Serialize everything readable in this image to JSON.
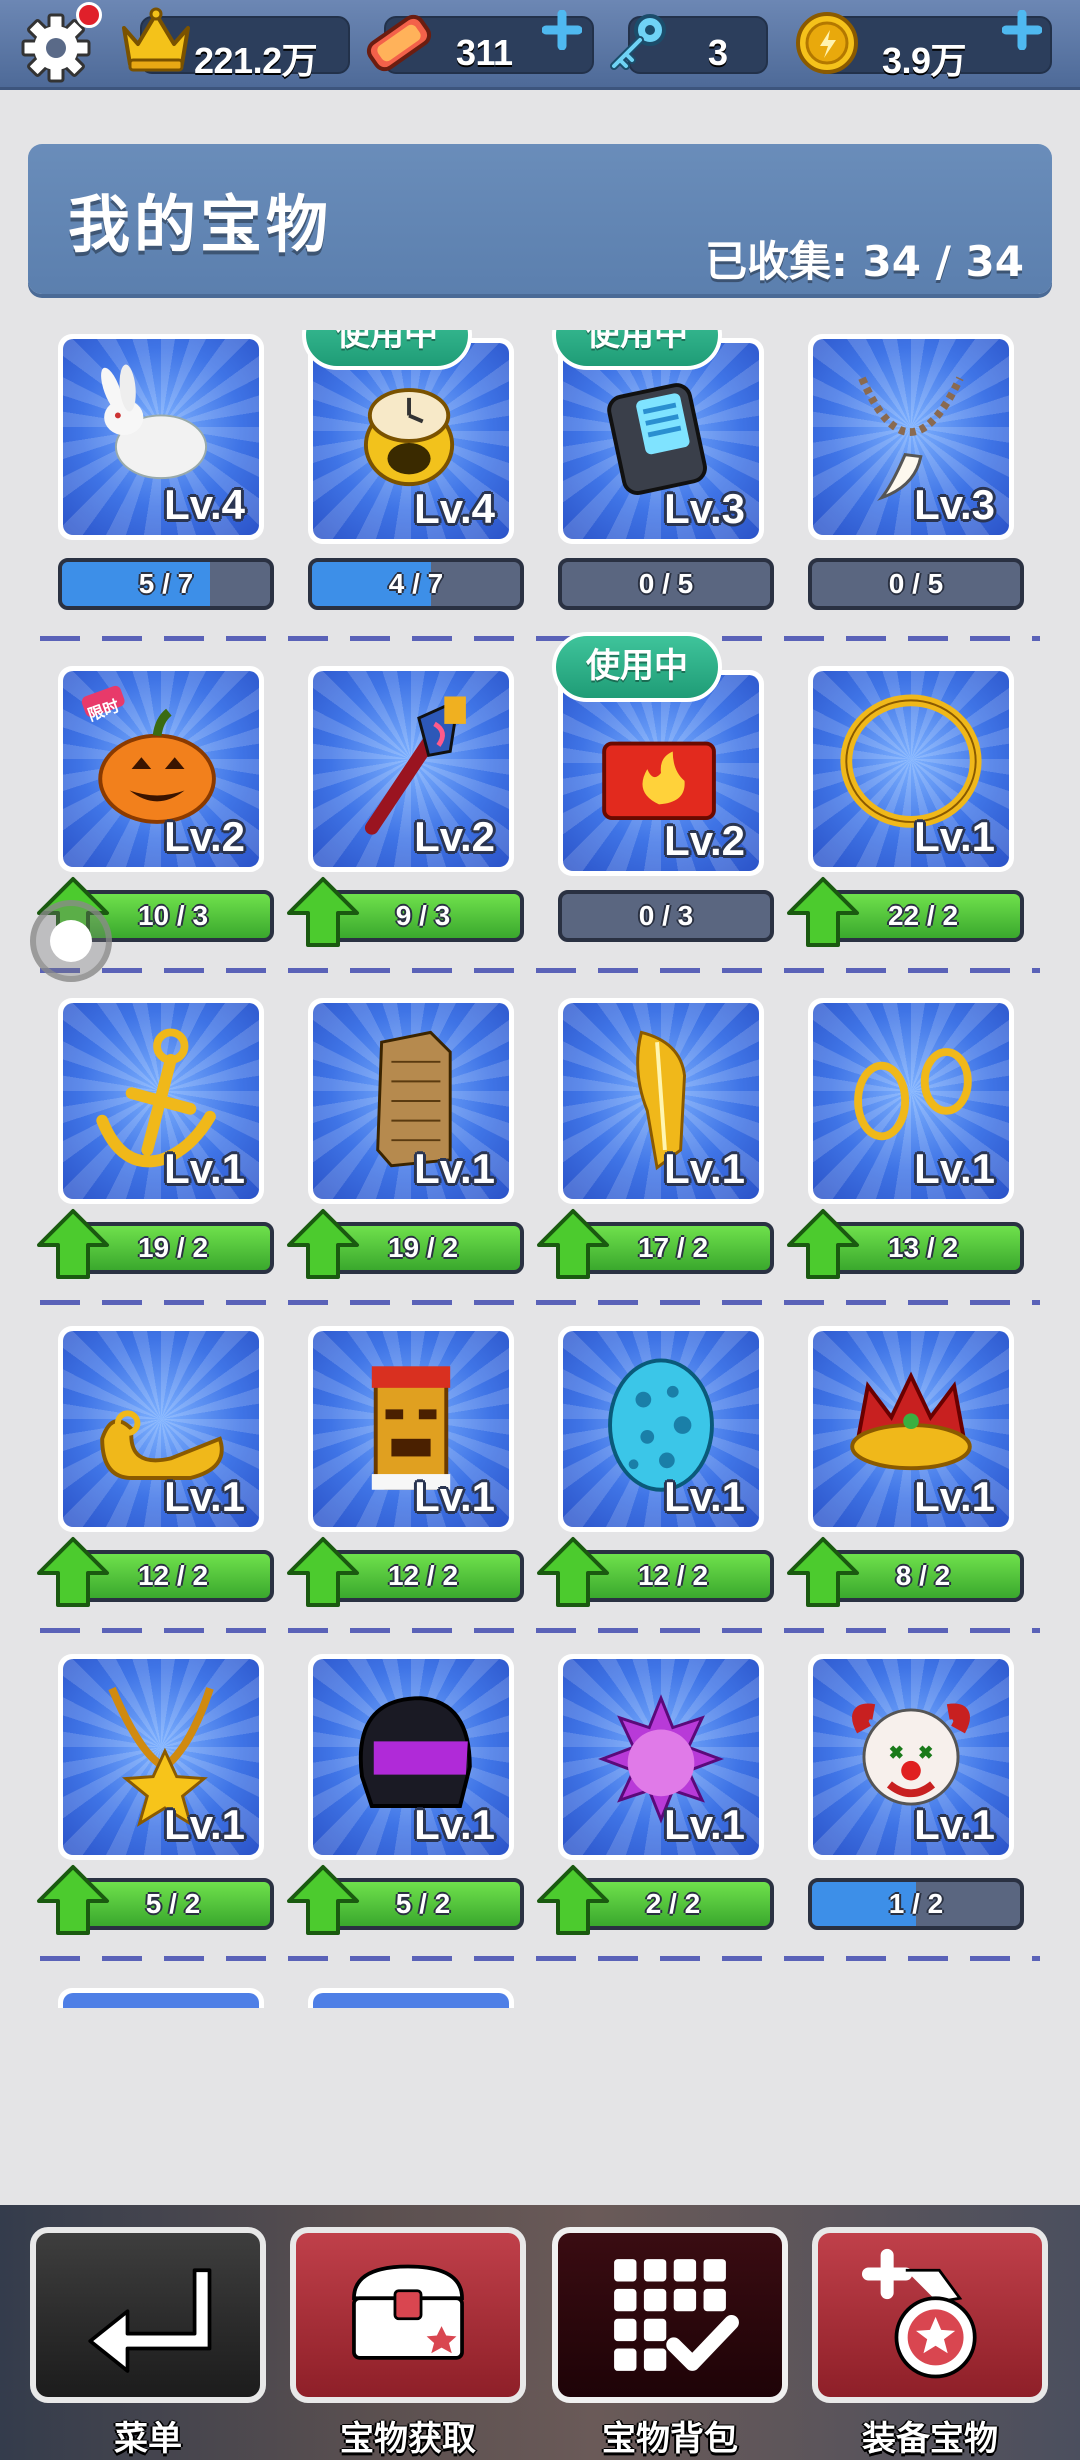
{
  "top_bar": {
    "crowns": "221.2万",
    "tickets": "311",
    "keys": "3",
    "coins": "3.9万"
  },
  "panel": {
    "title": "我的宝物",
    "collected": "已收集: 34 / 34"
  },
  "in_use_label": "使用中",
  "treasures": [
    {
      "item": "rabbit",
      "level": "Lv.4",
      "progress": "5 / 7",
      "bar": "blue-partial",
      "fill": 0.71,
      "in_use": false
    },
    {
      "item": "golden-stopwatch",
      "level": "Lv.4",
      "progress": "4 / 7",
      "bar": "blue-partial",
      "fill": 0.57,
      "in_use": true
    },
    {
      "item": "radio-device",
      "level": "Lv.3",
      "progress": "0 / 5",
      "bar": "grey",
      "fill": 0,
      "in_use": true
    },
    {
      "item": "fang-necklace",
      "level": "Lv.3",
      "progress": "0 / 5",
      "bar": "grey",
      "fill": 0,
      "in_use": false
    },
    {
      "item": "pumpkin",
      "level": "Lv.2",
      "progress": "10 / 3",
      "bar": "green",
      "fill": 1,
      "in_use": false,
      "tag": "限时"
    },
    {
      "item": "magic-wand",
      "level": "Lv.2",
      "progress": "9 / 3",
      "bar": "green",
      "fill": 1,
      "in_use": false
    },
    {
      "item": "fire-box",
      "level": "Lv.2",
      "progress": "0 / 3",
      "bar": "grey",
      "fill": 0,
      "in_use": true
    },
    {
      "item": "golden-ring",
      "level": "Lv.1",
      "progress": "22 / 2",
      "bar": "green",
      "fill": 1,
      "in_use": false
    },
    {
      "item": "anchor",
      "level": "Lv.1",
      "progress": "19 / 2",
      "bar": "green",
      "fill": 1,
      "in_use": false
    },
    {
      "item": "skyscraper",
      "level": "Lv.1",
      "progress": "19 / 2",
      "bar": "green",
      "fill": 1,
      "in_use": false
    },
    {
      "item": "yellow-feather",
      "level": "Lv.1",
      "progress": "17 / 2",
      "bar": "green",
      "fill": 1,
      "in_use": false
    },
    {
      "item": "gold-rings",
      "level": "Lv.1",
      "progress": "13 / 2",
      "bar": "green",
      "fill": 1,
      "in_use": false
    },
    {
      "item": "genie-slippers",
      "level": "Lv.1",
      "progress": "12 / 2",
      "bar": "green",
      "fill": 1,
      "in_use": false
    },
    {
      "item": "tiki-totem",
      "level": "Lv.1",
      "progress": "12 / 2",
      "bar": "green",
      "fill": 1,
      "in_use": false
    },
    {
      "item": "dragon-egg",
      "level": "Lv.1",
      "progress": "12 / 2",
      "bar": "green",
      "fill": 1,
      "in_use": false
    },
    {
      "item": "crown",
      "level": "Lv.1",
      "progress": "8 / 2",
      "bar": "green",
      "fill": 1,
      "in_use": false
    },
    {
      "item": "star-necklace",
      "level": "Lv.1",
      "progress": "5 / 2",
      "bar": "green",
      "fill": 1,
      "in_use": false
    },
    {
      "item": "racing-helmet",
      "level": "Lv.1",
      "progress": "5 / 2",
      "bar": "green",
      "fill": 1,
      "in_use": false
    },
    {
      "item": "crystal-orb",
      "level": "Lv.1",
      "progress": "2 / 2",
      "bar": "green",
      "fill": 1,
      "in_use": false
    },
    {
      "item": "clown-mask",
      "level": "Lv.1",
      "progress": "1 / 2",
      "bar": "blue-partial",
      "fill": 0.5,
      "in_use": false
    }
  ],
  "bottom_nav": [
    {
      "label": "菜单",
      "icon": "return-arrow-icon",
      "style": "dark"
    },
    {
      "label": "宝物获取",
      "icon": "treasure-chest-icon",
      "style": "red"
    },
    {
      "label": "宝物背包",
      "icon": "grid-check-icon",
      "style": "maroon"
    },
    {
      "label": "装备宝物",
      "icon": "equip-medal-icon",
      "style": "red"
    }
  ],
  "colors": {
    "panel_blue": "#5b7fae",
    "bar_green": "#4cc13a",
    "bar_blue": "#3d8fe8",
    "badge_green": "#28a880"
  }
}
